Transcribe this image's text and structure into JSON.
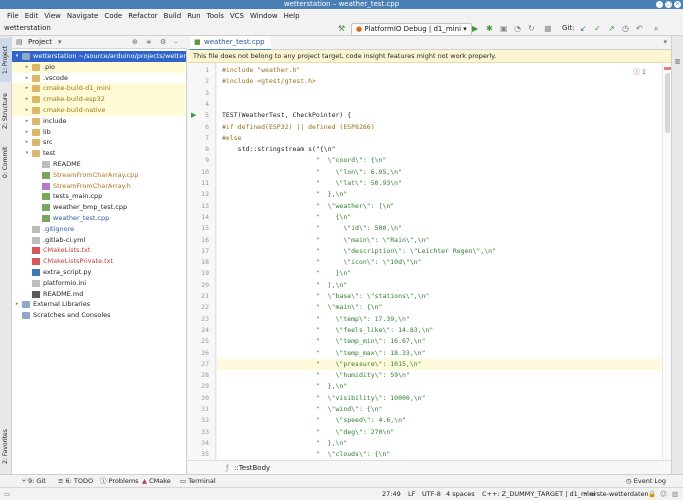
{
  "window": {
    "title": "wetterstation – weather_test.cpp"
  },
  "menu": [
    "File",
    "Edit",
    "View",
    "Navigate",
    "Code",
    "Refactor",
    "Build",
    "Run",
    "Tools",
    "VCS",
    "Window",
    "Help"
  ],
  "navbar": {
    "crumb": "wetterstation",
    "run_config": "PlatformIO Debug | d1_mini",
    "git_label": "Git:"
  },
  "left_tabs": {
    "project": "1: Project",
    "structure": "Z: Structure",
    "commit": "0: Commit",
    "favorites": "2: Favorites"
  },
  "project_panel": {
    "title": "Project"
  },
  "tree": [
    {
      "label": "wetterstation ~/source/arduino/projects/wetterstation",
      "depth": 0,
      "arrow": "▾",
      "icon": "folder-b",
      "style": "sel"
    },
    {
      "label": ".pio",
      "depth": 1,
      "arrow": "▸",
      "icon": "folder",
      "style": "yellowrow"
    },
    {
      "label": ".vscode",
      "depth": 1,
      "arrow": "▸",
      "icon": "folder",
      "style": ""
    },
    {
      "label": "cmake-build-d1_mini",
      "depth": 1,
      "arrow": "▸",
      "icon": "folder",
      "style": "yellowrow",
      "color": "#a07a1a"
    },
    {
      "label": "cmake-build-esp32",
      "depth": 1,
      "arrow": "▸",
      "icon": "folder",
      "style": "yellowrow",
      "color": "#a07a1a"
    },
    {
      "label": "cmake-build-native",
      "depth": 1,
      "arrow": "▸",
      "icon": "folder",
      "style": "yellowrow",
      "color": "#a07a1a"
    },
    {
      "label": "include",
      "depth": 1,
      "arrow": "▸",
      "icon": "folder",
      "style": ""
    },
    {
      "label": "lib",
      "depth": 1,
      "arrow": "▸",
      "icon": "folder",
      "style": ""
    },
    {
      "label": "src",
      "depth": 1,
      "arrow": "▸",
      "icon": "folder",
      "style": ""
    },
    {
      "label": "test",
      "depth": 1,
      "arrow": "▾",
      "icon": "folder",
      "style": ""
    },
    {
      "label": "README",
      "depth": 2,
      "arrow": "",
      "icon": "file-t",
      "style": ""
    },
    {
      "label": "StreamFromCharArray.cpp",
      "depth": 2,
      "arrow": "",
      "icon": "file-g",
      "style": "",
      "color": "#b5731a"
    },
    {
      "label": "StreamFromCharArray.h",
      "depth": 2,
      "arrow": "",
      "icon": "file-h",
      "style": "",
      "color": "#b5731a"
    },
    {
      "label": "tests_main.cpp",
      "depth": 2,
      "arrow": "",
      "icon": "file-g",
      "style": ""
    },
    {
      "label": "weather_bmp_test.cpp",
      "depth": 2,
      "arrow": "",
      "icon": "file-g",
      "style": ""
    },
    {
      "label": "weather_test.cpp",
      "depth": 2,
      "arrow": "",
      "icon": "file-g",
      "style": "",
      "color": "#2a57a1"
    },
    {
      "label": ".gitignore",
      "depth": 1,
      "arrow": "",
      "icon": "file-t",
      "style": "",
      "color": "#2a57a1"
    },
    {
      "label": ".gitlab-ci.yml",
      "depth": 1,
      "arrow": "",
      "icon": "file-t",
      "style": ""
    },
    {
      "label": "CMakeLists.txt",
      "depth": 1,
      "arrow": "",
      "icon": "file-c",
      "style": "",
      "color": "#c23b3b"
    },
    {
      "label": "CMakeListsPrivate.txt",
      "depth": 1,
      "arrow": "",
      "icon": "file-c",
      "style": "",
      "color": "#c23b3b"
    },
    {
      "label": "extra_script.py",
      "depth": 1,
      "arrow": "",
      "icon": "file-py",
      "style": ""
    },
    {
      "label": "platformio.ini",
      "depth": 1,
      "arrow": "",
      "icon": "file-t",
      "style": ""
    },
    {
      "label": "README.md",
      "depth": 1,
      "arrow": "",
      "icon": "file-md",
      "style": ""
    },
    {
      "label": "External Libraries",
      "depth": 0,
      "arrow": "▸",
      "icon": "folder-b",
      "style": ""
    },
    {
      "label": "Scratches and Consoles",
      "depth": 0,
      "arrow": "",
      "icon": "folder-b",
      "style": ""
    }
  ],
  "editor": {
    "tab": "weather_test.cpp",
    "banner": "This file does not belong to any project target, code insight features might not work properly.",
    "warning_count": "1",
    "current_line": 27,
    "lines": [
      {
        "n": 1,
        "t": "#include \"weather.h\"",
        "c": "pp"
      },
      {
        "n": 2,
        "t": "#include <gtest/gtest.h>",
        "c": "pp"
      },
      {
        "n": 3,
        "t": "",
        "c": ""
      },
      {
        "n": 4,
        "t": "",
        "c": ""
      },
      {
        "n": 5,
        "t": "TEST(WeatherTest, CheckPointer) {",
        "c": ""
      },
      {
        "n": 6,
        "t": "#if defined(ESP32) || defined (ESP8266)",
        "c": "pp"
      },
      {
        "n": 7,
        "t": "#else",
        "c": "pp"
      },
      {
        "n": 8,
        "t": "    std::stringstream s(\"{\\n\"",
        "c": ""
      },
      {
        "n": 9,
        "t": "                        \"  \\\"coord\\\": {\\n\"",
        "c": "s"
      },
      {
        "n": 10,
        "t": "                        \"    \\\"lon\\\": 6.95,\\n\"",
        "c": "s"
      },
      {
        "n": 11,
        "t": "                        \"    \\\"lat\\\": 50.93\\n\"",
        "c": "s"
      },
      {
        "n": 12,
        "t": "                        \"  },\\n\"",
        "c": "s"
      },
      {
        "n": 13,
        "t": "                        \"  \\\"weather\\\": [\\n\"",
        "c": "s"
      },
      {
        "n": 14,
        "t": "                        \"    {\\n\"",
        "c": "s"
      },
      {
        "n": 15,
        "t": "                        \"      \\\"id\\\": 500,\\n\"",
        "c": "s"
      },
      {
        "n": 16,
        "t": "                        \"      \\\"main\\\": \\\"Rain\\\",\\n\"",
        "c": "s"
      },
      {
        "n": 17,
        "t": "                        \"      \\\"description\\\": \\\"Leichter Regen\\\",\\n\"",
        "c": "s"
      },
      {
        "n": 18,
        "t": "                        \"      \\\"icon\\\": \\\"10d\\\"\\n\"",
        "c": "s"
      },
      {
        "n": 19,
        "t": "                        \"    }\\n\"",
        "c": "s"
      },
      {
        "n": 20,
        "t": "                        \"  ],\\n\"",
        "c": "s"
      },
      {
        "n": 21,
        "t": "                        \"  \\\"base\\\": \\\"stations\\\",\\n\"",
        "c": "s"
      },
      {
        "n": 22,
        "t": "                        \"  \\\"main\\\": {\\n\"",
        "c": "s"
      },
      {
        "n": 23,
        "t": "                        \"    \\\"temp\\\": 17.39,\\n\"",
        "c": "s"
      },
      {
        "n": 24,
        "t": "                        \"    \\\"feels_like\\\": 14.83,\\n\"",
        "c": "s"
      },
      {
        "n": 25,
        "t": "                        \"    \\\"temp_min\\\": 16.67,\\n\"",
        "c": "s"
      },
      {
        "n": 26,
        "t": "                        \"    \\\"temp_max\\\": 18.33,\\n\"",
        "c": "s"
      },
      {
        "n": 27,
        "t": "                        \"    \\\"pressure\\\": 1015,\\n\"",
        "c": "s"
      },
      {
        "n": 28,
        "t": "                        \"    \\\"humidity\\\": 59\\n\"",
        "c": "s"
      },
      {
        "n": 29,
        "t": "                        \"  },\\n\"",
        "c": "s"
      },
      {
        "n": 30,
        "t": "                        \"  \\\"visibility\\\": 10000,\\n\"",
        "c": "s"
      },
      {
        "n": 31,
        "t": "                        \"  \\\"wind\\\": {\\n\"",
        "c": "s"
      },
      {
        "n": 32,
        "t": "                        \"    \\\"speed\\\": 4.6,\\n\"",
        "c": "s"
      },
      {
        "n": 33,
        "t": "                        \"    \\\"deg\\\": 270\\n\"",
        "c": "s"
      },
      {
        "n": 34,
        "t": "                        \"  },\\n\"",
        "c": "s"
      },
      {
        "n": 35,
        "t": "                        \"  \\\"clouds\\\": {\\n\"",
        "c": "s"
      }
    ],
    "breadcrumb": "::TestBody"
  },
  "tool_tabs": {
    "git": "9: Git",
    "todo": "6: TODO",
    "problems": "Problems",
    "cmake": "CMake",
    "terminal": "Terminal",
    "event_log": "Event Log"
  },
  "status": {
    "position": "27:49",
    "line_sep": "LF",
    "encoding": "UTF-8",
    "indent": "4 spaces",
    "context": "C++: Z_DUMMY_TARGET | d1_mini",
    "branch": "erste-wetterdaten"
  }
}
